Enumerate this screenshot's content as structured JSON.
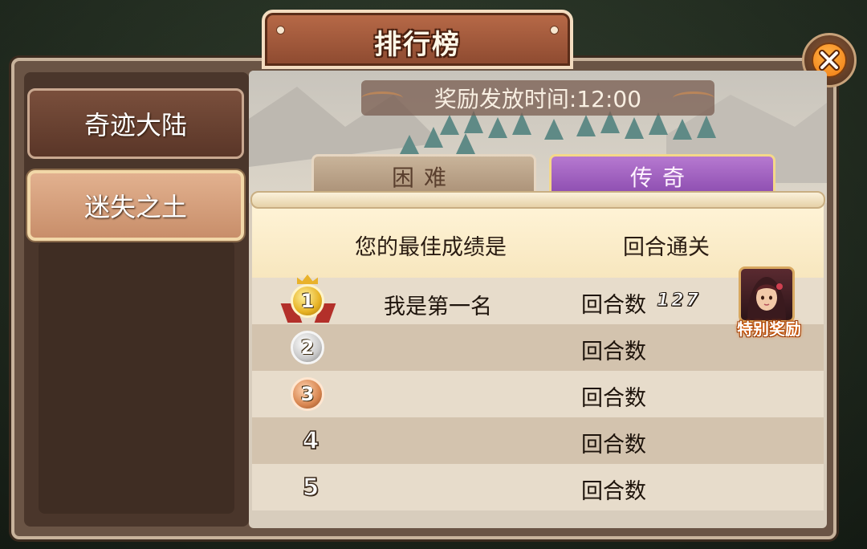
{
  "window": {
    "title": "排行榜"
  },
  "sidebar": {
    "items": [
      {
        "label": "奇迹大陆",
        "selected": false
      },
      {
        "label": "迷失之土",
        "selected": true
      }
    ]
  },
  "reward_time_text": "奖励发放时间:12:00",
  "tabs": [
    {
      "label": "困难",
      "selected": false
    },
    {
      "label": "传奇",
      "selected": true
    }
  ],
  "header": {
    "best_score_label": "您的最佳成绩是",
    "clear_label": "回合通关"
  },
  "rows": [
    {
      "rank": "1",
      "medal": "gold",
      "name": "我是第一名",
      "rounds_label": "回合数",
      "rounds_value": "127"
    },
    {
      "rank": "2",
      "medal": "silver",
      "name": "",
      "rounds_label": "回合数",
      "rounds_value": ""
    },
    {
      "rank": "3",
      "medal": "bronze",
      "name": "",
      "rounds_label": "回合数",
      "rounds_value": ""
    },
    {
      "rank": "4",
      "medal": "",
      "name": "",
      "rounds_label": "回合数",
      "rounds_value": ""
    },
    {
      "rank": "5",
      "medal": "",
      "name": "",
      "rounds_label": "回合数",
      "rounds_value": ""
    }
  ],
  "special_reward": {
    "label": "特别奖励",
    "icon": "hero-portrait-icon"
  },
  "close_icon": "close-icon",
  "colors": {
    "accent_orange": "#f07a10",
    "legend_purple": "#8a4aae",
    "frame_brown": "#6a5445"
  }
}
